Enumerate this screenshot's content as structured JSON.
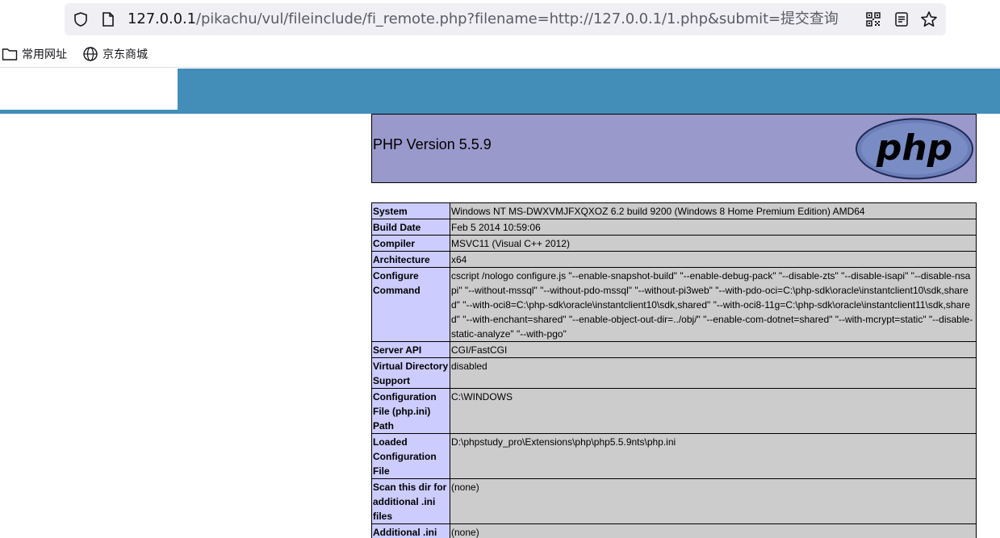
{
  "browser": {
    "url_host": "127.0.0.1",
    "url_path": "/pikachu/vul/fileinclude/fi_remote.php?filename=http://127.0.0.1/1.php&submit=提交查询"
  },
  "bookmarks": [
    {
      "label": "常用网址"
    },
    {
      "label": "京东商城"
    }
  ],
  "phpinfo": {
    "version_title": "PHP Version 5.5.9",
    "logo_text": "php",
    "rows": [
      {
        "key": "System",
        "value": "Windows NT MS-DWXVMJFXQXOZ 6.2 build 9200 (Windows 8 Home Premium Edition) AMD64"
      },
      {
        "key": "Build Date",
        "value": "Feb 5 2014 10:59:06"
      },
      {
        "key": "Compiler",
        "value": "MSVC11 (Visual C++ 2012)"
      },
      {
        "key": "Architecture",
        "value": "x64"
      },
      {
        "key": "Configure Command",
        "value": "cscript /nologo configure.js \"--enable-snapshot-build\" \"--enable-debug-pack\" \"--disable-zts\" \"--disable-isapi\" \"--disable-nsapi\" \"--without-mssql\" \"--without-pdo-mssql\" \"--without-pi3web\" \"--with-pdo-oci=C:\\php-sdk\\oracle\\instantclient10\\sdk,shared\" \"--with-oci8=C:\\php-sdk\\oracle\\instantclient10\\sdk,shared\" \"--with-oci8-11g=C:\\php-sdk\\oracle\\instantclient11\\sdk,shared\" \"--with-enchant=shared\" \"--enable-object-out-dir=../obj/\" \"--enable-com-dotnet=shared\" \"--with-mcrypt=static\" \"--disable-static-analyze\" \"--with-pgo\""
      },
      {
        "key": "Server API",
        "value": "CGI/FastCGI"
      },
      {
        "key": "Virtual Directory Support",
        "value": "disabled"
      },
      {
        "key": "Configuration File (php.ini) Path",
        "value": "C:\\WINDOWS"
      },
      {
        "key": "Loaded Configuration File",
        "value": "D:\\phpstudy_pro\\Extensions\\php\\php5.5.9nts\\php.ini"
      },
      {
        "key": "Scan this dir for additional .ini files",
        "value": "(none)"
      },
      {
        "key": "Additional .ini files parsed",
        "value": "(none)"
      }
    ]
  },
  "colors": {
    "header_blue": "#438eb9",
    "php_head": "#9999cc",
    "key_cell": "#ccccff",
    "value_cell": "#cccccc"
  }
}
